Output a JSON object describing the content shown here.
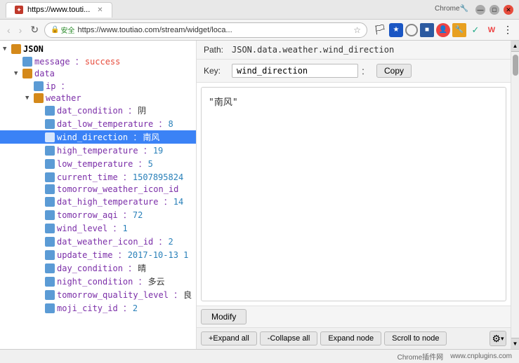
{
  "browser": {
    "tab": {
      "title": "https://www.touti...",
      "favicon": "🔴"
    },
    "address": {
      "secure_label": "安全",
      "url_full": "https://www.toutiao.com/stream/widget/loca...",
      "url_short": "https://www.touti..."
    }
  },
  "path_row": {
    "label": "Path:",
    "value": "JSON.data.weather.wind_direction"
  },
  "key_row": {
    "label": "Key:",
    "value": "wind_direction",
    "copy_label": "Copy"
  },
  "value_display": {
    "text": "\"南风\""
  },
  "modify": {
    "label": "Modify"
  },
  "toolbar": {
    "expand_all": "+Expand all",
    "collapse_all": "-Collapse all",
    "expand_node": "Expand node",
    "scroll_to_node": "Scroll to node"
  },
  "tree": {
    "nodes": [
      {
        "id": "json-root",
        "indent": 0,
        "expanded": true,
        "type": "folder",
        "key": "JSON",
        "value": "",
        "key_color": "root"
      },
      {
        "id": "message",
        "indent": 1,
        "expanded": false,
        "type": "field",
        "key": "message ：",
        "value": "success",
        "value_color": "success"
      },
      {
        "id": "data",
        "indent": 1,
        "expanded": true,
        "type": "folder",
        "key": "data",
        "value": "",
        "key_color": "purple"
      },
      {
        "id": "ip",
        "indent": 2,
        "expanded": false,
        "type": "field",
        "key": "ip ：",
        "value": "",
        "key_color": "purple"
      },
      {
        "id": "weather",
        "indent": 2,
        "expanded": true,
        "type": "folder",
        "key": "weather",
        "value": "",
        "key_color": "purple"
      },
      {
        "id": "dat_condition",
        "indent": 3,
        "type": "field",
        "key": "dat_condition ：",
        "value": "阴",
        "key_color": "purple"
      },
      {
        "id": "dat_low_temperature",
        "indent": 3,
        "type": "field",
        "key": "dat_low_temperature ：",
        "value": "8",
        "key_color": "purple",
        "value_color": "num"
      },
      {
        "id": "wind_direction",
        "indent": 3,
        "type": "field",
        "key": "wind_direction ：",
        "value": "南风",
        "key_color": "purple",
        "selected": true
      },
      {
        "id": "high_temperature",
        "indent": 3,
        "type": "field",
        "key": "high_temperature ：",
        "value": "19",
        "key_color": "purple",
        "value_color": "num"
      },
      {
        "id": "low_temperature",
        "indent": 3,
        "type": "field",
        "key": "low_temperature ：",
        "value": "5",
        "key_color": "purple",
        "value_color": "num"
      },
      {
        "id": "current_time",
        "indent": 3,
        "type": "field",
        "key": "current_time ：",
        "value": "1507895824",
        "key_color": "purple",
        "value_color": "num"
      },
      {
        "id": "tomorrow_weather_icon_id",
        "indent": 3,
        "type": "field",
        "key": "tomorrow_weather_icon_id",
        "value": "",
        "key_color": "purple"
      },
      {
        "id": "dat_high_temperature",
        "indent": 3,
        "type": "field",
        "key": "dat_high_temperature ：",
        "value": "14",
        "key_color": "purple",
        "value_color": "num"
      },
      {
        "id": "tomorrow_aqi",
        "indent": 3,
        "type": "field",
        "key": "tomorrow_aqi ：",
        "value": "72",
        "key_color": "purple",
        "value_color": "num"
      },
      {
        "id": "wind_level",
        "indent": 3,
        "type": "field",
        "key": "wind_level ：",
        "value": "1",
        "key_color": "purple",
        "value_color": "num"
      },
      {
        "id": "dat_weather_icon_id",
        "indent": 3,
        "type": "field",
        "key": "dat_weather_icon_id ：",
        "value": "2",
        "key_color": "purple",
        "value_color": "num"
      },
      {
        "id": "update_time",
        "indent": 3,
        "type": "field",
        "key": "update_time ：",
        "value": "2017-10-13 1",
        "key_color": "purple"
      },
      {
        "id": "day_condition",
        "indent": 3,
        "type": "field",
        "key": "day_condition ：",
        "value": "晴",
        "key_color": "purple"
      },
      {
        "id": "night_condition",
        "indent": 3,
        "type": "field",
        "key": "night_condition ：",
        "value": "多云",
        "key_color": "purple"
      },
      {
        "id": "tomorrow_quality_level",
        "indent": 3,
        "type": "field",
        "key": "tomorrow_quality_level ：",
        "value": "良",
        "key_color": "purple"
      },
      {
        "id": "moji_city_id",
        "indent": 3,
        "type": "field",
        "key": "moji_city_id ：",
        "value": "2",
        "key_color": "purple",
        "value_color": "num"
      }
    ]
  },
  "bottom_bar": {
    "site1": "Chrome插件网",
    "site2": "www.cnplugins.com"
  }
}
